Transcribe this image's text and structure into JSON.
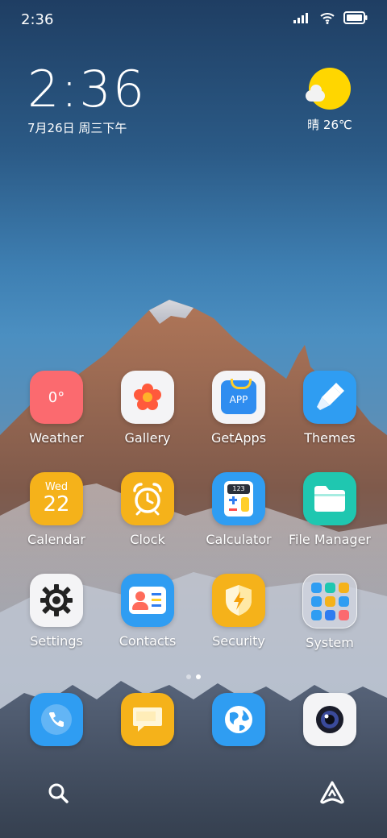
{
  "status_bar": {
    "time": "2:36"
  },
  "clock_widget": {
    "time": "2:36",
    "date": "7月26日 周三下午"
  },
  "weather_widget": {
    "text": "晴 26℃"
  },
  "apps": [
    {
      "label": "Weather",
      "icon": "weather-icon",
      "badge": "0°",
      "color": "#fb6a6f"
    },
    {
      "label": "Gallery",
      "icon": "gallery-flower-icon",
      "color": "#f4f4f6"
    },
    {
      "label": "GetApps",
      "icon": "getapps-bag-icon",
      "badge": "APP",
      "color": "#f4f4f6"
    },
    {
      "label": "Themes",
      "icon": "themes-brush-icon",
      "color": "#2f9df2"
    },
    {
      "label": "Calendar",
      "icon": "calendar-icon",
      "day_name": "Wed",
      "day_number": "22",
      "color": "#f5b21a"
    },
    {
      "label": "Clock",
      "icon": "alarm-clock-icon",
      "color": "#f5b21a"
    },
    {
      "label": "Calculator",
      "icon": "calculator-icon",
      "badge": "123",
      "color": "#2f9df2"
    },
    {
      "label": "File Manager",
      "icon": "folder-icon",
      "color": "#1fc7b0"
    },
    {
      "label": "Settings",
      "icon": "settings-gear-icon",
      "color": "#f4f4f6"
    },
    {
      "label": "Contacts",
      "icon": "contact-card-icon",
      "color": "#2f9df2"
    },
    {
      "label": "Security",
      "icon": "security-shield-icon",
      "color": "#f5b21a"
    },
    {
      "label": "System",
      "icon": "system-folder-icon",
      "color": "#d9dbe2"
    }
  ],
  "dock": [
    {
      "icon": "phone-icon",
      "color": "#2f9df2"
    },
    {
      "icon": "messages-icon",
      "color": "#f5b21a"
    },
    {
      "icon": "browser-globe-icon",
      "color": "#2f9df2"
    },
    {
      "icon": "camera-icon",
      "color": "#f4f4f6"
    }
  ],
  "bottom_bar": {
    "left_icon": "search-icon",
    "right_icon": "assistant-icon"
  }
}
